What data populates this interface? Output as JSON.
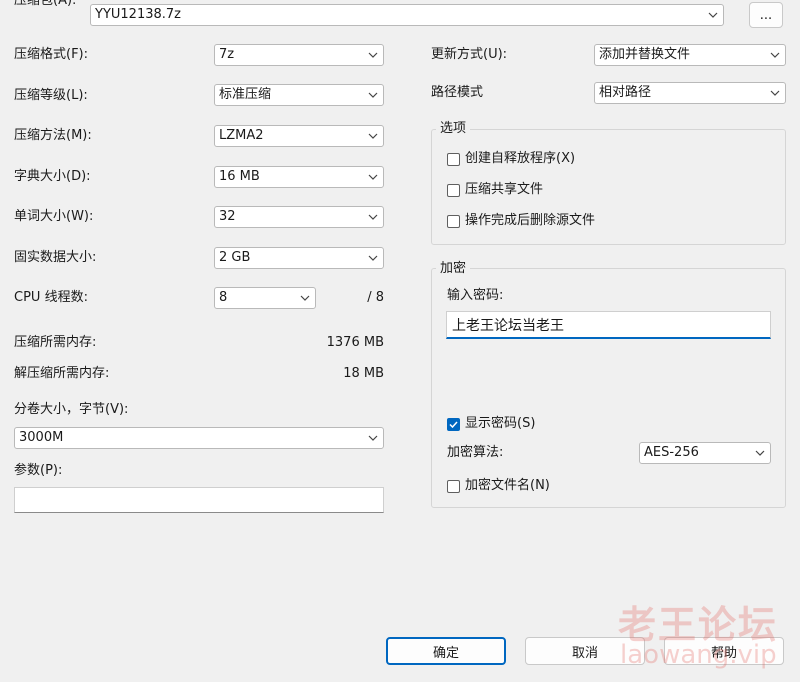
{
  "archive": {
    "label": "压缩包(A):",
    "value": "YYU12138.7z",
    "browse_label": "..."
  },
  "left": {
    "format": {
      "label": "压缩格式(F):",
      "value": "7z"
    },
    "level": {
      "label": "压缩等级(L):",
      "value": "标准压缩"
    },
    "method": {
      "label": "压缩方法(M):",
      "value": "LZMA2"
    },
    "dict": {
      "label": "字典大小(D):",
      "value": "16 MB"
    },
    "word": {
      "label": "单词大小(W):",
      "value": "32"
    },
    "solid": {
      "label": "固实数据大小:",
      "value": "2 GB"
    },
    "threads": {
      "label": "CPU 线程数:",
      "value": "8",
      "max": "/ 8"
    },
    "mem_comp": {
      "label": "压缩所需内存:",
      "value": "1376 MB"
    },
    "mem_decomp": {
      "label": "解压缩所需内存:",
      "value": "18 MB"
    },
    "volume": {
      "label": "分卷大小，字节(V):",
      "value": "3000M"
    },
    "params": {
      "label": "参数(P):",
      "value": ""
    }
  },
  "right": {
    "update": {
      "label": "更新方式(U):",
      "value": "添加并替换文件"
    },
    "path": {
      "label": "路径模式",
      "value": "相对路径"
    },
    "options": {
      "title": "选项",
      "sfx": {
        "label": "创建自释放程序(X)",
        "checked": false
      },
      "shared": {
        "label": "压缩共享文件",
        "checked": false
      },
      "delete": {
        "label": "操作完成后删除源文件",
        "checked": false
      }
    },
    "encryption": {
      "title": "加密",
      "password_label": "输入密码:",
      "password_value": "上老王论坛当老王",
      "show_password": {
        "label": "显示密码(S)",
        "checked": true
      },
      "method_label": "加密算法:",
      "method_value": "AES-256",
      "encrypt_names": {
        "label": "加密文件名(N)",
        "checked": false
      }
    }
  },
  "buttons": {
    "ok": "确定",
    "cancel": "取消",
    "help": "帮助"
  },
  "watermark": {
    "cn": "老王论坛",
    "url": "laowang.vip"
  }
}
